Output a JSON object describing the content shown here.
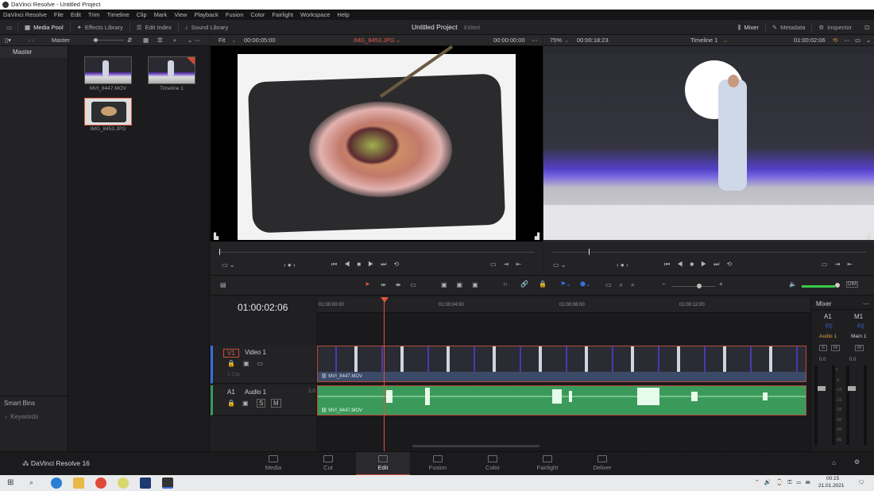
{
  "window": {
    "title": "DaVinci Resolve - Untitled Project"
  },
  "menu": [
    "DaVinci Resolve",
    "File",
    "Edit",
    "Trim",
    "Timeline",
    "Clip",
    "Mark",
    "View",
    "Playback",
    "Fusion",
    "Color",
    "Fairlight",
    "Workspace",
    "Help"
  ],
  "toolbar": {
    "media_pool": "Media Pool",
    "effects_library": "Effects Library",
    "edit_index": "Edit Index",
    "sound_library": "Sound Library",
    "project_title": "Untitled Project",
    "project_status": "Edited",
    "mixer": "Mixer",
    "metadata": "Metadata",
    "inspector": "Inspector"
  },
  "pool_header": {
    "bin": "Master"
  },
  "source_viewer": {
    "fit": "Fit",
    "duration": "00:00:05:00",
    "clip": "IMG_8453.JPG",
    "timecode": "00:00:00:00"
  },
  "timeline_viewer": {
    "zoom": "75%",
    "duration": "00:00:18:23",
    "timeline": "Timeline 1",
    "timecode": "01:00:02:06"
  },
  "bins": {
    "master": "Master",
    "smart_bins": "Smart Bins",
    "keywords": "Keywords"
  },
  "clips": [
    {
      "name": "MVI_8447.MOV"
    },
    {
      "name": "Timeline 1"
    },
    {
      "name": "IMG_8453.JPG"
    }
  ],
  "timeline": {
    "timecode": "01:00:02:06",
    "ruler": [
      "01:00:00:00",
      "01:00:04:00",
      "01:00:08:00",
      "01:00:12:00"
    ],
    "video_track": {
      "id": "V1",
      "name": "Video 1",
      "clip": "MVI_8447.MOV",
      "clips_count": "1 Clip"
    },
    "audio_track": {
      "id": "A1",
      "name": "Audio 1",
      "level": "2.0",
      "clip": "MVI_8447.MOV",
      "solo": "S",
      "mute": "M"
    }
  },
  "mixer": {
    "title": "Mixer",
    "ch1": "A1",
    "ch2": "M1",
    "eq": "EQ",
    "audio1": "Audio 1",
    "main1": "Main 1",
    "val1": "0.0",
    "val2": "0.0",
    "scale": [
      "0",
      "-5",
      "-10",
      "-15",
      "-20",
      "-30",
      "-40",
      "-50"
    ]
  },
  "pages": [
    "Media",
    "Cut",
    "Edit",
    "Fusion",
    "Color",
    "Fairlight",
    "Deliver"
  ],
  "active_page": "Edit",
  "brand": "DaVinci Resolve 16",
  "taskbar": {
    "time": "00:15",
    "date": "21.01.2021"
  },
  "colors": {
    "accent": "#c94b3a",
    "audio": "#3a9a5a",
    "playhead": "#e0533b"
  }
}
